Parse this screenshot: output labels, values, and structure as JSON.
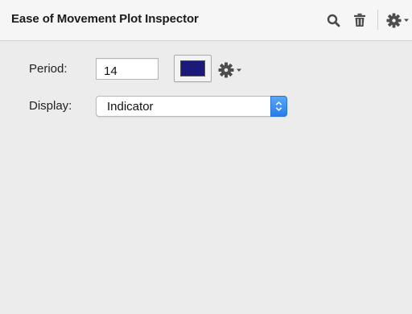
{
  "header": {
    "title": "Ease of Movement Plot Inspector",
    "icons": {
      "search": "search-icon",
      "trash": "trash-icon",
      "gear_menu": "gear-icon"
    }
  },
  "form": {
    "period": {
      "label": "Period:",
      "value": "14"
    },
    "color_well": {
      "color": "#1a1a7a"
    },
    "display": {
      "label": "Display:",
      "selected": "Indicator"
    }
  },
  "colors": {
    "panel_bg": "#ececec",
    "header_bg": "#f6f6f6",
    "accent": "#2a7de8",
    "plot_color": "#1a1a7a"
  }
}
